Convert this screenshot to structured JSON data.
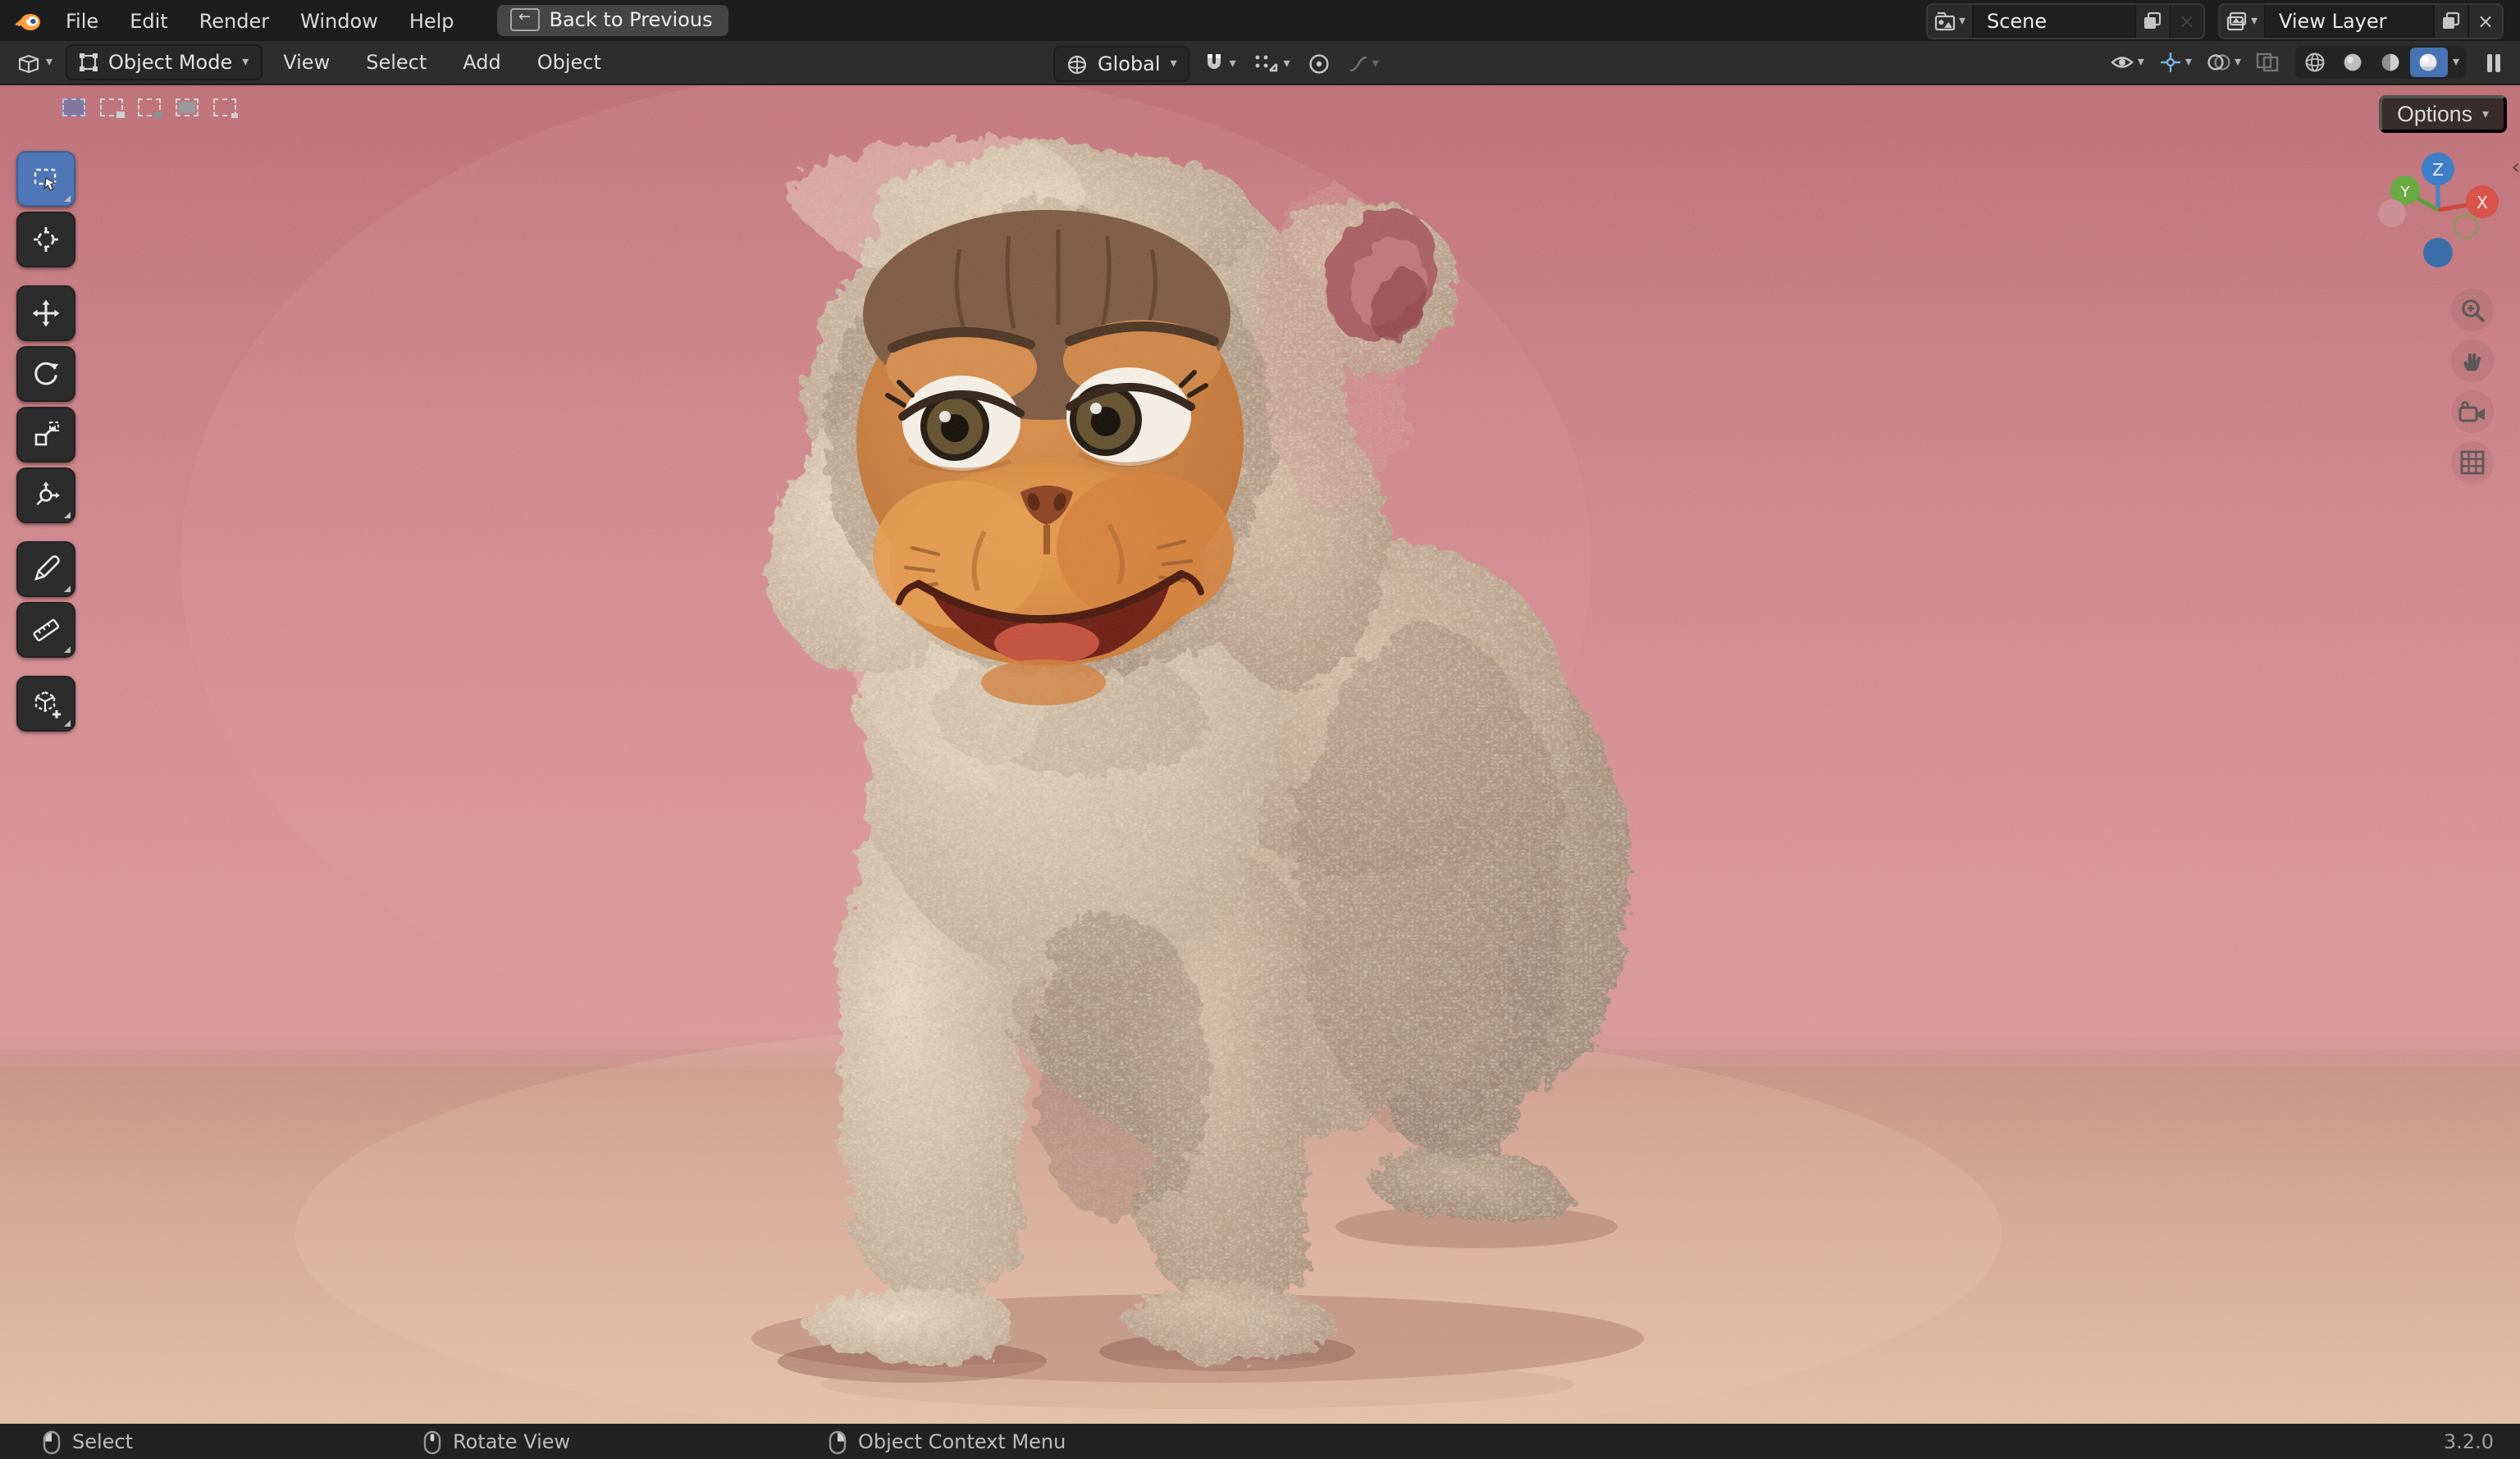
{
  "topbar": {
    "menus": [
      "File",
      "Edit",
      "Render",
      "Window",
      "Help"
    ],
    "back_button": "Back to Previous",
    "scene": {
      "label": "Scene"
    },
    "view_layer": {
      "label": "View Layer"
    }
  },
  "viewport_header": {
    "mode": "Object Mode",
    "menus": [
      "View",
      "Select",
      "Add",
      "Object"
    ],
    "orientation": "Global"
  },
  "viewport": {
    "options_button": "Options",
    "axis_labels": {
      "z": "Z",
      "x": "X",
      "y": "Y"
    }
  },
  "toolbar": {
    "tools": [
      "box-select",
      "cursor",
      "move",
      "rotate",
      "scale",
      "transform",
      "annotate",
      "measure",
      "add-cube"
    ],
    "active_tool": "box-select"
  },
  "nav": {
    "buttons": [
      "zoom",
      "pan",
      "camera",
      "toggle-projection"
    ]
  },
  "statusbar": {
    "hints": [
      {
        "button": "left-mouse",
        "label": "Select"
      },
      {
        "button": "middle-mouse",
        "label": "Rotate View"
      },
      {
        "button": "right-mouse",
        "label": "Object Context Menu"
      }
    ],
    "version": "3.2.0"
  },
  "colors": {
    "accent": "#4772b3",
    "viewport_background": "#cd868b",
    "floor": "#ddb8a3",
    "header_background": "#2d2d2d",
    "topbar_background": "#1d1d1d"
  }
}
